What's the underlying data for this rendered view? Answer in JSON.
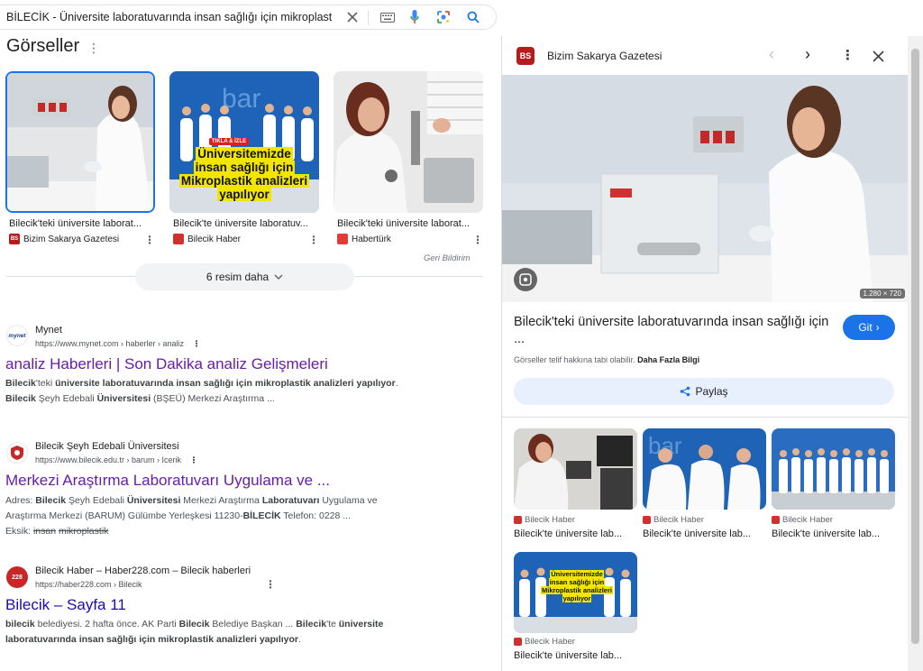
{
  "search": {
    "query": "BİLECİK - Üniversite laboratuvarında insan sağlığı için mikroplastik analiz"
  },
  "images_section": {
    "title": "Görseller",
    "items": [
      {
        "caption": "Bilecik'teki üniversite laborat...",
        "source": "Bizim Sakarya Gazetesi"
      },
      {
        "caption": "Bilecik'te üniversite laboratuv...",
        "source": "Bilecik Haber"
      },
      {
        "caption": "Bilecik'teki üniversite laborat...",
        "source": "Habertürk"
      }
    ],
    "overlay_badge": "TIKLA & İZLE",
    "overlay_text": [
      "Üniversitemizde",
      "insan sağlığı için",
      "Mikroplastik analizleri",
      "yapılıyor"
    ],
    "banner_text": "bar",
    "feedback": "Geri Bildirim",
    "more_button": "6 resim daha"
  },
  "results": [
    {
      "site": "Mynet",
      "favicon_text": "mynet",
      "url": "https://www.mynet.com › haberler › analiz",
      "title": "analiz Haberleri | Son Dakika analiz Gelişmeleri",
      "snippet_line1": [
        {
          "t": "Bilecik",
          "b": true
        },
        {
          "t": "'teki ",
          "b": false
        },
        {
          "t": "üniversite laboratuvarında insan sağlığı için mikroplastik analizleri yapılıyor",
          "b": true
        },
        {
          "t": ".",
          "b": false
        }
      ],
      "snippet_line2": [
        {
          "t": "Bilecik",
          "b": true
        },
        {
          "t": " Şeyh Edebali ",
          "b": false
        },
        {
          "t": "Üniversitesi",
          "b": true
        },
        {
          "t": " (BŞEÜ) Merkezi Araştırma ...",
          "b": false
        }
      ]
    },
    {
      "site": "Bilecik Şeyh Edebali Üniversitesi",
      "url": "https://www.bilecik.edu.tr › barum › Icerik",
      "title": "Merkezi Araştırma Laboratuvarı Uygulama ve ...",
      "snippet_line1": [
        {
          "t": "Adres: ",
          "b": false
        },
        {
          "t": "Bilecik",
          "b": true
        },
        {
          "t": " Şeyh Edebali ",
          "b": false
        },
        {
          "t": "Üniversitesi",
          "b": true
        },
        {
          "t": " Merkezi Araştırma ",
          "b": false
        },
        {
          "t": "Laboratuvarı",
          "b": true
        },
        {
          "t": " Uygulama ve",
          "b": false
        }
      ],
      "snippet_line2": [
        {
          "t": "Araştırma Merkezi (BARUM) Gülümbe Yerleşkesi 11230-",
          "b": false
        },
        {
          "t": "BİLECİK",
          "b": true
        },
        {
          "t": " Telefon: 0228 ...",
          "b": false
        }
      ],
      "missing_label": "Eksik:",
      "missing_terms": [
        "insan",
        "mikroplastik"
      ]
    },
    {
      "site": "Bilecik Haber – Haber228.com – Bilecik haberleri",
      "favicon_text": "228",
      "url": "https://haber228.com › Bilecik",
      "title": "Bilecik – Sayfa 11",
      "snippet_line1": [
        {
          "t": "bilecik",
          "b": true
        },
        {
          "t": " belediyesi. 2 hafta önce. AK Parti ",
          "b": false
        },
        {
          "t": "Bilecik",
          "b": true
        },
        {
          "t": " Belediye Başkan ... ",
          "b": false
        },
        {
          "t": "Bilecik",
          "b": true
        },
        {
          "t": "'te ",
          "b": false
        },
        {
          "t": "üniversite",
          "b": true
        }
      ],
      "snippet_line2": [
        {
          "t": "laboratuvarında insan sağlığı için mikroplastik analizleri yapılıyor",
          "b": true
        },
        {
          "t": ".",
          "b": false
        }
      ]
    }
  ],
  "panel": {
    "source": "Bizim Sakarya Gazetesi",
    "logo_text": "BS",
    "dimensions": "1.280 × 720",
    "title": "Bilecik'teki üniversite laboratuvarında insan sağlığı için ...",
    "go_button": "Git",
    "copyright_text": "Görseller telif hakkına tabi olabilir.",
    "copyright_link": "Daha Fazla Bilgi",
    "share_button": "Paylaş",
    "related": [
      {
        "source": "Bilecik Haber",
        "title": "Bilecik'te üniversite lab..."
      },
      {
        "source": "Bilecik Haber",
        "title": "Bilecik'te üniversite lab..."
      },
      {
        "source": "Bilecik Haber",
        "title": "Bilecik'te üniversite lab..."
      },
      {
        "source": "Bilecik Haber",
        "title": "Bilecik'te üniversite lab..."
      }
    ]
  },
  "colors": {
    "accent_blue": "#1a73e8",
    "visited_link": "#681da8",
    "link": "#1a0dab",
    "overlay_yellow": "#f2e600",
    "banner_blue": "#1e63b8"
  }
}
